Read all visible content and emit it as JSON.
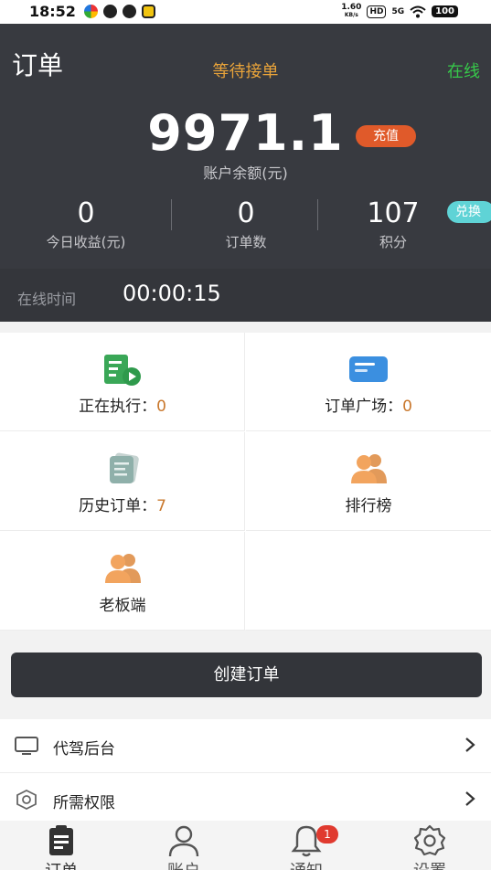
{
  "status_bar": {
    "time": "18:52",
    "net_speed_value": "1.60",
    "net_speed_unit": "KB/s",
    "hd_label": "HD",
    "network_label": "5G",
    "battery": "100"
  },
  "header": {
    "title": "订单",
    "order_status": "等待接单",
    "online_status": "在线",
    "balance_value": "9971.1",
    "recharge_label": "充值",
    "balance_label": "账户余额(元)",
    "stats": [
      {
        "value": "0",
        "label": "今日收益(元)"
      },
      {
        "value": "0",
        "label": "订单数"
      },
      {
        "value": "107",
        "label": "积分"
      }
    ],
    "exchange_label": "兑换",
    "online_time_label": "在线时间",
    "online_time_value": "00:00:15"
  },
  "grid": {
    "cells": [
      {
        "label": "正在执行：",
        "count": "0",
        "icon": "executing-video-icon"
      },
      {
        "label": "订单广场：",
        "count": "0",
        "icon": "chat-card-icon"
      },
      {
        "label": "历史订单：",
        "count": "7",
        "icon": "stacked-papers-icon"
      },
      {
        "label": "排行榜",
        "count": "",
        "icon": "users-icon"
      },
      {
        "label": "老板端",
        "count": "",
        "icon": "users-icon"
      }
    ]
  },
  "create_order_label": "创建订单",
  "menu": [
    {
      "label": "代驾后台",
      "icon": "monitor-icon"
    },
    {
      "label": "所需权限",
      "icon": "shield-icon"
    }
  ],
  "tabbar": {
    "tabs": [
      {
        "label": "订单",
        "icon": "clipboard-icon"
      },
      {
        "label": "账户",
        "icon": "person-icon"
      },
      {
        "label": "通知",
        "icon": "bell-icon",
        "badge": "1"
      },
      {
        "label": "设置",
        "icon": "gear-icon"
      }
    ]
  },
  "colors": {
    "header_bg": "#383a40",
    "accent_orange": "#e05a2a",
    "online_green": "#37c94a",
    "waiting_amber": "#e8a33a",
    "exchange_teal": "#5fd3d6",
    "count_orange": "#c9782d",
    "badge_red": "#e03a2f"
  }
}
